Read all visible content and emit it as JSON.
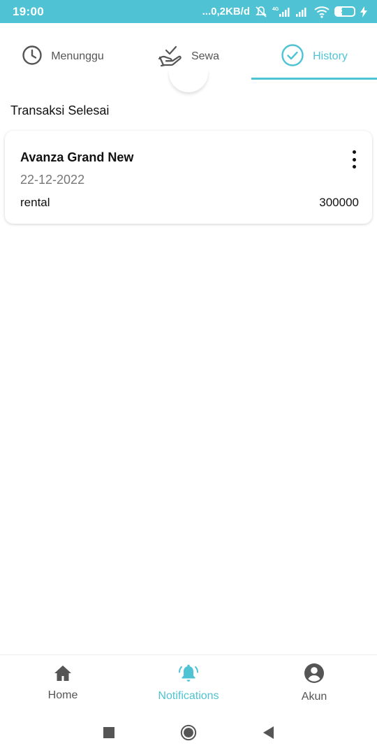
{
  "status_bar": {
    "time": "19:00",
    "network_speed": "...0,2KB/d",
    "battery_level": "36",
    "battery_fraction": 0.36,
    "icons": [
      "mute-icon",
      "signal-4g-icon",
      "signal-icon",
      "wifi-icon",
      "battery-icon",
      "charging-icon"
    ]
  },
  "tabs": [
    {
      "label": "Menunggu",
      "icon": "clock-icon",
      "active": false
    },
    {
      "label": "Sewa",
      "icon": "hand-check-icon",
      "active": false
    },
    {
      "label": "History",
      "icon": "check-circle-icon",
      "active": true
    }
  ],
  "section": {
    "title": "Transaksi Selesai"
  },
  "transactions": [
    {
      "title": "Avanza Grand New",
      "date": "22-12-2022",
      "type": "rental",
      "amount": "300000",
      "menu_icon": "more-vertical-icon"
    }
  ],
  "bottom_nav": [
    {
      "label": "Home",
      "icon": "home-icon",
      "active": false
    },
    {
      "label": "Notifications",
      "icon": "bell-icon",
      "active": true
    },
    {
      "label": "Akun",
      "icon": "account-icon",
      "active": false
    }
  ],
  "system_nav": [
    "recents-icon",
    "home-circle-icon",
    "back-icon"
  ],
  "colors": {
    "accent": "#4fc3d3",
    "text": "#111111",
    "muted": "#777777"
  }
}
